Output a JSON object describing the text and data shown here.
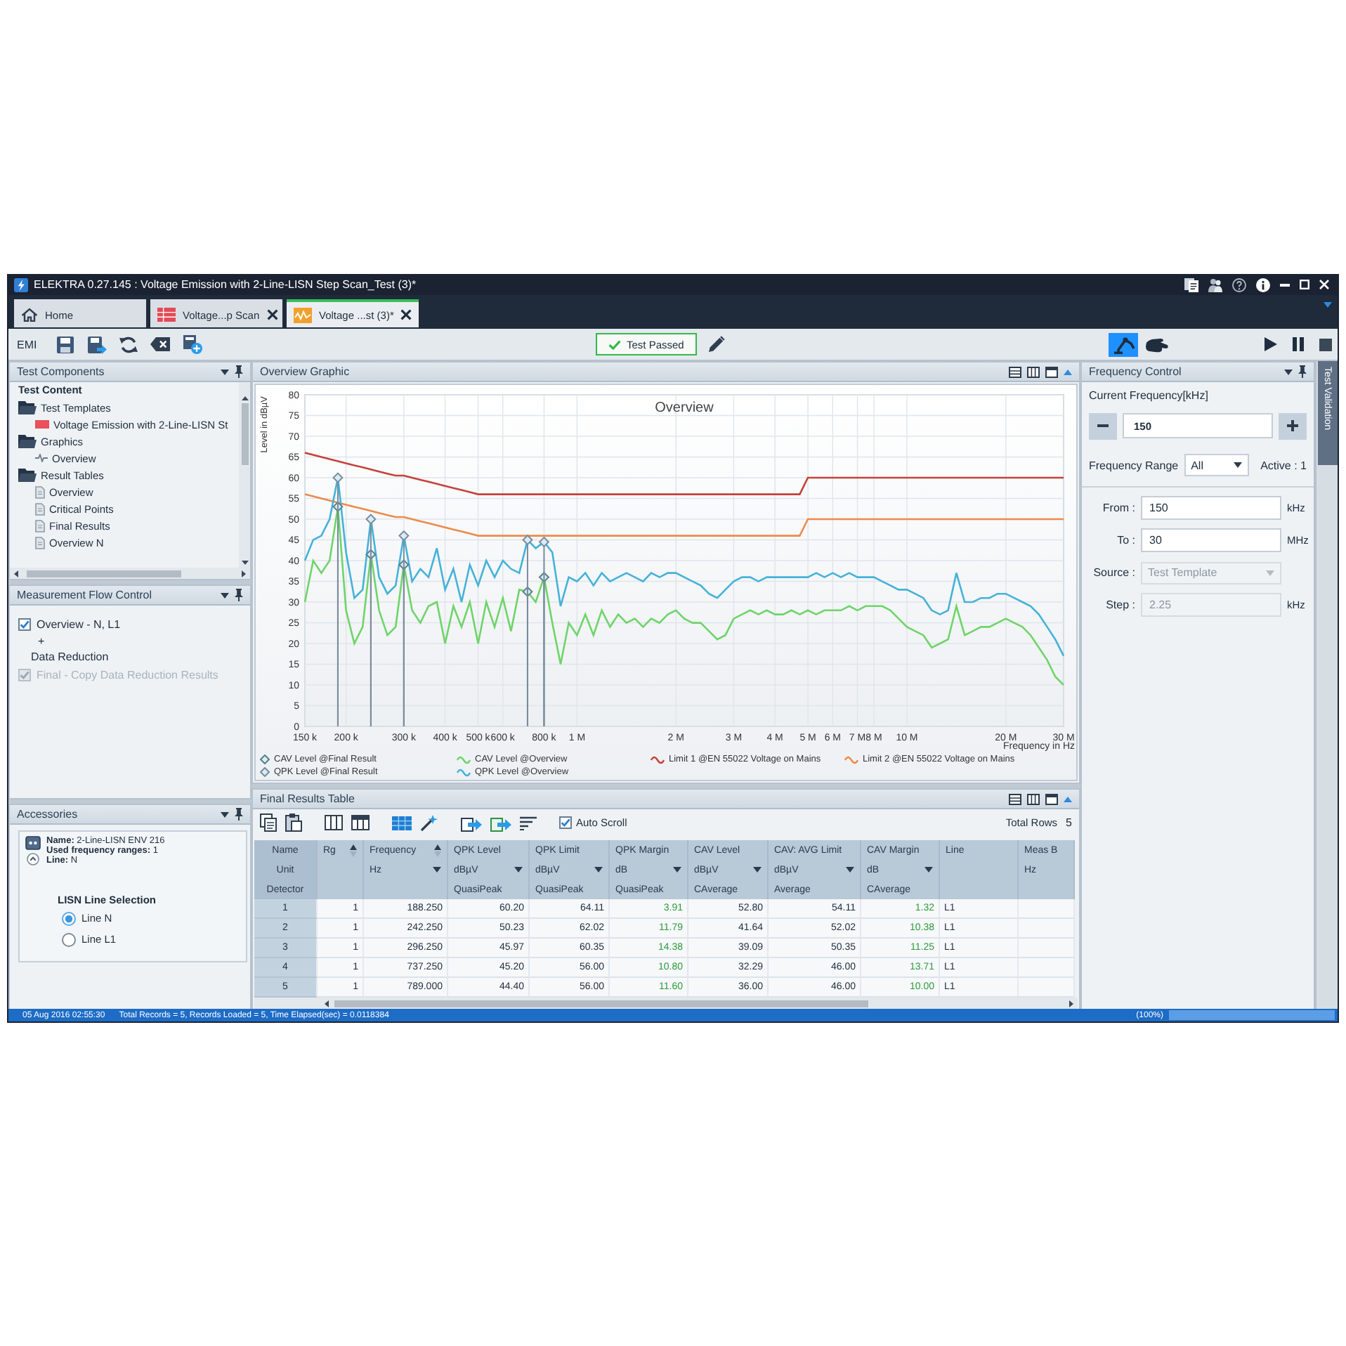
{
  "window": {
    "title": "ELEKTRA 0.27.145 : Voltage Emission with 2-Line-LISN Step Scan_Test (3)*"
  },
  "tabs": [
    {
      "label": "Home",
      "kind": "home",
      "selected": false,
      "closable": false
    },
    {
      "label": "Voltage...p Scan",
      "kind": "table",
      "selected": false,
      "closable": true
    },
    {
      "label": "Voltage ...st (3)*",
      "kind": "graph",
      "selected": true,
      "closable": true
    }
  ],
  "toolbar": {
    "label": "EMI",
    "status": {
      "label": "Test Passed",
      "passed": true
    },
    "modes": [
      {
        "kind": "arm",
        "selected": true
      },
      {
        "kind": "hand",
        "selected": false
      }
    ]
  },
  "test_components": {
    "title": "Test Components",
    "root": "Test Content",
    "items": [
      {
        "label": "Test Templates",
        "kind": "folder",
        "children": [
          {
            "label": "Voltage Emission with 2-Line-LISN St",
            "kind": "template"
          }
        ]
      },
      {
        "label": "Graphics",
        "kind": "folder",
        "children": [
          {
            "label": "Overview",
            "kind": "graph"
          }
        ]
      },
      {
        "label": "Result Tables",
        "kind": "folder",
        "children": [
          {
            "label": "Overview",
            "kind": "table"
          },
          {
            "label": "Critical Points",
            "kind": "table"
          },
          {
            "label": "Final Results",
            "kind": "table"
          },
          {
            "label": "Overview N",
            "kind": "table"
          }
        ]
      }
    ]
  },
  "flow_control": {
    "title": "Measurement Flow Control",
    "items": [
      {
        "kind": "step",
        "label": "Overview - N, L1",
        "checked": true,
        "disabled": false
      },
      {
        "kind": "operator",
        "label": "+"
      },
      {
        "kind": "text",
        "label": "Data Reduction"
      },
      {
        "kind": "step",
        "label": "Final - Copy Data Reduction Results",
        "checked": true,
        "disabled": true
      }
    ]
  },
  "accessories": {
    "title": "Accessories",
    "device": {
      "expanded": true,
      "lines": [
        "**Name:** 2-Line-LISN ENV 216",
        "**Used frequency ranges:** 1",
        "**Line:** N"
      ]
    },
    "line_selection": {
      "title": "LISN Line Selection",
      "options": [
        {
          "label": "Line N",
          "selected": true
        },
        {
          "label": "Line L1",
          "selected": false
        }
      ]
    }
  },
  "graphic": {
    "title": "Overview Graphic",
    "chart_data": {
      "type": "line",
      "title": "Overview",
      "xlabel": "Frequency in Hz",
      "ylabel": "Level in dBµV",
      "ylim": [
        0,
        80
      ],
      "grid": true,
      "legend": "bottom",
      "yticks": [
        0,
        5,
        10,
        15,
        20,
        25,
        30,
        35,
        40,
        45,
        50,
        55,
        60,
        65,
        70,
        75,
        80
      ],
      "categories": [
        "150 k",
        null,
        null,
        null,
        null,
        "200 k",
        null,
        null,
        null,
        null,
        null,
        null,
        "300 k",
        null,
        null,
        null,
        null,
        "400 k",
        null,
        null,
        null,
        "500 k",
        null,
        null,
        "600 k",
        null,
        null,
        null,
        null,
        "800 k",
        null,
        null,
        null,
        "1 M",
        null,
        null,
        null,
        null,
        null,
        null,
        null,
        null,
        null,
        null,
        null,
        "2 M",
        null,
        null,
        null,
        null,
        null,
        null,
        "3 M",
        null,
        null,
        null,
        null,
        "4 M",
        null,
        null,
        null,
        "5 M",
        null,
        null,
        "6 M",
        null,
        null,
        "7 M",
        null,
        "8 M",
        null,
        null,
        null,
        "10 M",
        null,
        null,
        null,
        null,
        null,
        null,
        null,
        null,
        null,
        null,
        null,
        "20 M",
        null,
        null,
        null,
        null,
        null,
        null,
        "30 M"
      ],
      "series": [
        {
          "name": "CAV Level @Final Result",
          "color": "#5b7f8a",
          "marker": "diamond",
          "values": [
            null,
            null,
            null,
            null,
            53,
            null,
            null,
            null,
            41.5,
            null,
            null,
            null,
            39,
            null,
            null,
            null,
            null,
            null,
            null,
            null,
            null,
            null,
            null,
            null,
            null,
            null,
            null,
            32.5,
            null,
            36,
            null,
            null,
            null,
            null,
            null,
            null,
            null,
            null,
            null,
            null,
            null,
            null,
            null,
            null,
            null,
            null,
            null,
            null,
            null,
            null,
            null,
            null,
            null,
            null,
            null,
            null,
            null,
            null,
            null,
            null,
            null,
            null,
            null,
            null,
            null,
            null,
            null,
            null,
            null,
            null,
            null,
            null,
            null,
            null,
            null,
            null,
            null,
            null,
            null,
            null,
            null,
            null,
            null,
            null,
            null,
            null,
            null,
            null,
            null,
            null,
            null,
            null,
            null
          ]
        },
        {
          "name": "CAV Level @Overview",
          "color": "#6fd46a",
          "values": [
            30,
            40,
            37,
            40,
            53,
            28,
            20,
            24,
            41.5,
            28,
            22,
            24,
            39,
            28,
            25,
            29,
            30,
            20,
            29,
            24,
            30,
            20,
            30,
            24,
            31,
            23,
            33,
            32.5,
            30,
            36,
            25,
            15,
            25,
            22,
            27,
            22,
            28,
            24,
            27,
            25,
            26,
            24,
            26,
            25,
            27,
            28,
            26,
            25,
            25,
            23,
            21,
            22,
            26,
            27,
            28,
            27,
            28,
            27,
            27,
            28,
            27,
            28,
            27,
            28,
            28,
            28,
            29,
            28,
            29,
            29,
            29,
            28,
            26,
            24,
            23,
            22,
            19,
            20,
            21,
            29,
            22,
            23,
            24,
            24,
            25,
            26,
            25,
            24,
            22,
            19,
            16,
            12,
            10
          ]
        },
        {
          "name": "Limit 1 @EN 55022 Voltage on Mains",
          "color": "#c4423a",
          "values": [
            66,
            65.5,
            65,
            64.5,
            64,
            63.5,
            63,
            62.5,
            62,
            61.5,
            61,
            60.5,
            60.5,
            60,
            59.5,
            59,
            58.5,
            58,
            57.5,
            57,
            56.5,
            56,
            56,
            56,
            56,
            56,
            56,
            56,
            56,
            56,
            56,
            56,
            56,
            56,
            56,
            56,
            56,
            56,
            56,
            56,
            56,
            56,
            56,
            56,
            56,
            56,
            56,
            56,
            56,
            56,
            56,
            56,
            56,
            56,
            56,
            56,
            56,
            56,
            56,
            56,
            56,
            60,
            60,
            60,
            60,
            60,
            60,
            60,
            60,
            60,
            60,
            60,
            60,
            60,
            60,
            60,
            60,
            60,
            60,
            60,
            60,
            60,
            60,
            60,
            60,
            60,
            60,
            60,
            60,
            60,
            60,
            60,
            60
          ]
        },
        {
          "name": "Limit 2 @EN 55022 Voltage on Mains",
          "color": "#ee8a4c",
          "values": [
            56,
            55.5,
            55,
            54.5,
            54,
            53.5,
            53,
            52.5,
            52,
            51.5,
            51,
            50.5,
            50.5,
            50,
            49.5,
            49,
            48.5,
            48,
            47.5,
            47,
            46.5,
            46,
            46,
            46,
            46,
            46,
            46,
            46,
            46,
            46,
            46,
            46,
            46,
            46,
            46,
            46,
            46,
            46,
            46,
            46,
            46,
            46,
            46,
            46,
            46,
            46,
            46,
            46,
            46,
            46,
            46,
            46,
            46,
            46,
            46,
            46,
            46,
            46,
            46,
            46,
            46,
            50,
            50,
            50,
            50,
            50,
            50,
            50,
            50,
            50,
            50,
            50,
            50,
            50,
            50,
            50,
            50,
            50,
            50,
            50,
            50,
            50,
            50,
            50,
            50,
            50,
            50,
            50,
            50,
            50,
            50,
            50,
            50
          ]
        },
        {
          "name": "QPK Level @Final Result",
          "color": "#7a8c9c",
          "marker": "diamond",
          "values": [
            null,
            null,
            null,
            null,
            60,
            null,
            null,
            null,
            50,
            null,
            null,
            null,
            46,
            null,
            null,
            null,
            null,
            null,
            null,
            null,
            null,
            null,
            null,
            null,
            null,
            null,
            null,
            45,
            null,
            44.5,
            null,
            null,
            null,
            null,
            null,
            null,
            null,
            null,
            null,
            null,
            null,
            null,
            null,
            null,
            null,
            null,
            null,
            null,
            null,
            null,
            null,
            null,
            null,
            null,
            null,
            null,
            null,
            null,
            null,
            null,
            null,
            null,
            null,
            null,
            null,
            null,
            null,
            null,
            null,
            null,
            null,
            null,
            null,
            null,
            null,
            null,
            null,
            null,
            null,
            null,
            null,
            null,
            null,
            null,
            null,
            null,
            null,
            null,
            null,
            null,
            null,
            null,
            null
          ]
        },
        {
          "name": "QPK Level @Overview",
          "color": "#45b2d8",
          "values": [
            40,
            45,
            46,
            50,
            60,
            42,
            31,
            33,
            50,
            36,
            32,
            34,
            46,
            35,
            38,
            36,
            43,
            33,
            38,
            30,
            39,
            34,
            40,
            36,
            40,
            38,
            37,
            45,
            43,
            44.5,
            42,
            29,
            36,
            35,
            37,
            34,
            37,
            35,
            36,
            37,
            36,
            35,
            37,
            36,
            37,
            37,
            36,
            35,
            34,
            32,
            31,
            33,
            35,
            36,
            36,
            35,
            36,
            36,
            36,
            36,
            36,
            36,
            37,
            36,
            37,
            36,
            37,
            36,
            36,
            36,
            35,
            34,
            33,
            33,
            32,
            31,
            28,
            27,
            28,
            37,
            30,
            30,
            31,
            31,
            32,
            32,
            31,
            30,
            29,
            27,
            24,
            21,
            17
          ]
        }
      ]
    }
  },
  "results": {
    "title": "Final Results Table",
    "auto_scroll": {
      "label": "Auto Scroll",
      "checked": true
    },
    "total_label": "Total Rows",
    "total": "5",
    "table": {
      "row_labels": [
        "Name",
        "Unit",
        "Detector"
      ],
      "columns": [
        {
          "name": "Rg",
          "sorted": true,
          "kind": "number"
        },
        {
          "name": "Frequency",
          "unit": "Hz",
          "dropdown": true,
          "sorted": true,
          "kind": "number"
        },
        {
          "name": "QPK Level",
          "unit": "dBµV",
          "dropdown": true,
          "detector": "QuasiPeak",
          "sorted": false,
          "kind": "number"
        },
        {
          "name": "QPK Limit",
          "unit": "dBµV",
          "dropdown": true,
          "detector": "QuasiPeak",
          "sorted": false,
          "kind": "number"
        },
        {
          "name": "QPK Margin",
          "unit": "dB",
          "dropdown": true,
          "detector": "QuasiPeak",
          "sorted": false,
          "kind": "margin"
        },
        {
          "name": "CAV Level",
          "unit": "dBµV",
          "dropdown": true,
          "detector": "CAverage",
          "sorted": false,
          "kind": "number"
        },
        {
          "name": "CAV: AVG Limit",
          "unit": "dBµV",
          "dropdown": true,
          "detector": "Average",
          "sorted": false,
          "kind": "number"
        },
        {
          "name": "CAV Margin",
          "unit": "dB",
          "dropdown": true,
          "detector": "CAverage",
          "sorted": false,
          "kind": "margin"
        },
        {
          "name": "Line",
          "sorted": false,
          "kind": "text"
        },
        {
          "name": "Meas B",
          "unit": "Hz",
          "dropdown": false,
          "sorted": false,
          "kind": "number"
        }
      ],
      "rows": [
        {
          "label": "1",
          "cells": [
            "1",
            "188.250",
            "60.20",
            "64.11",
            "3.91",
            "52.80",
            "54.11",
            "1.32",
            "L1"
          ]
        },
        {
          "label": "2",
          "cells": [
            "1",
            "242.250",
            "50.23",
            "62.02",
            "11.79",
            "41.64",
            "52.02",
            "10.38",
            "L1"
          ]
        },
        {
          "label": "3",
          "cells": [
            "1",
            "296.250",
            "45.97",
            "60.35",
            "14.38",
            "39.09",
            "50.35",
            "11.25",
            "L1"
          ]
        },
        {
          "label": "4",
          "cells": [
            "1",
            "737.250",
            "45.20",
            "56.00",
            "10.80",
            "32.29",
            "46.00",
            "13.71",
            "L1"
          ]
        },
        {
          "label": "5",
          "cells": [
            "1",
            "789.000",
            "44.40",
            "56.00",
            "11.60",
            "36.00",
            "46.00",
            "10.00",
            "L1"
          ]
        }
      ]
    }
  },
  "frequency_control": {
    "title": "Frequency Control",
    "current_label": "Current Frequency[kHz]",
    "current_value": "150",
    "range": {
      "label": "Frequency Range",
      "value": "All",
      "active": "Active : 1"
    },
    "fields": [
      {
        "label": "From :",
        "kind": "input",
        "value": "150",
        "unit": "kHz",
        "disabled": false
      },
      {
        "label": "To :",
        "kind": "input",
        "value": "30",
        "unit": "MHz",
        "disabled": false
      },
      {
        "label": "Source :",
        "kind": "dropdown",
        "value": "Test Template",
        "disabled": true
      },
      {
        "label": "Step :",
        "kind": "input",
        "value": "2.25",
        "unit": "kHz",
        "disabled": true
      }
    ]
  },
  "side_tab": {
    "label": "Test Validation"
  },
  "status_bar": {
    "time": "05 Aug 2016 02:55:30",
    "message": "Total Records = 5, Records Loaded = 5, Time Elapsed(sec) = 0.0118384",
    "progress": {
      "label": "(100%)",
      "level": 1
    }
  }
}
